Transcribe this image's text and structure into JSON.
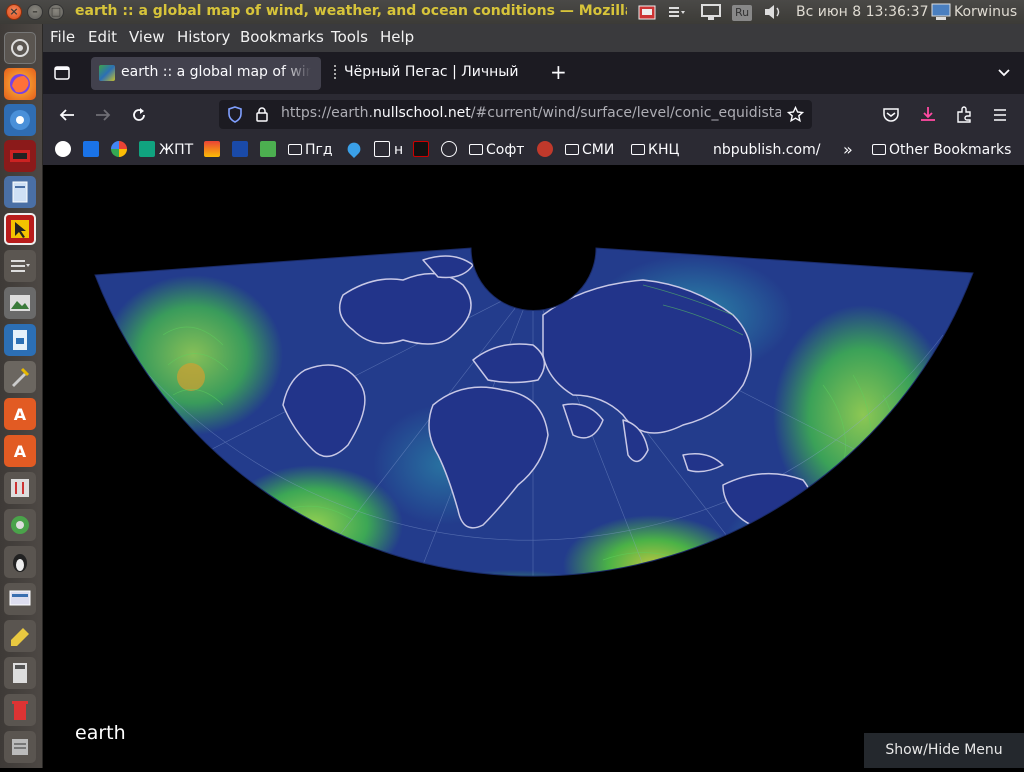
{
  "window": {
    "title": "earth :: a global map of wind, weather, and ocean conditions — Mozilla Firefox"
  },
  "system_tray": {
    "keyboard_layout": "Ru",
    "clock": "Вс июн  8 13:36:37",
    "user": "Korwinus"
  },
  "menubar": {
    "items": [
      "File",
      "Edit",
      "View",
      "History",
      "Bookmarks",
      "Tools",
      "Help"
    ]
  },
  "tabs": [
    {
      "title": "earth :: a global map of wind",
      "active": true
    },
    {
      "title": "Чёрный Пегас | Личный",
      "active": false
    }
  ],
  "address_bar": {
    "url_prefix": "https://earth.",
    "url_domain": "nullschool.net",
    "url_path": "/#current/wind/surface/level/conic_equidistant"
  },
  "bookmarks": {
    "items": [
      {
        "label": "",
        "icon": "star-icon"
      },
      {
        "label": "",
        "icon": "at-icon"
      },
      {
        "label": "",
        "icon": "google-icon"
      },
      {
        "label": "ЖПТ",
        "icon": "chatgpt-icon"
      },
      {
        "label": "",
        "icon": "gmail-icon"
      },
      {
        "label": "",
        "icon": "cross-icon"
      },
      {
        "label": "",
        "icon": "torrent-icon"
      },
      {
        "label": "Пгд",
        "icon": "folder-icon"
      },
      {
        "label": "",
        "icon": "drop-icon"
      },
      {
        "label": "н",
        "icon": "edit-icon"
      },
      {
        "label": "",
        "icon": "red-triangle-icon"
      },
      {
        "label": "",
        "icon": "globe-icon"
      },
      {
        "label": "Софт",
        "icon": "folder-icon"
      },
      {
        "label": "",
        "icon": "soviet-icon"
      },
      {
        "label": "СМИ",
        "icon": "folder-icon"
      },
      {
        "label": "КНЦ",
        "icon": "folder-icon"
      },
      {
        "label": "nbpublish.com/",
        "icon": ""
      }
    ],
    "other": "Other Bookmarks"
  },
  "page": {
    "logo_text": "earth",
    "menu_button": "Show/Hide Menu"
  },
  "colors": {
    "ocean_base": "#233c8c",
    "wind_fast": "#3fc63f",
    "coastline": "#c8c8e6",
    "title_yellow": "#d7c43a"
  }
}
